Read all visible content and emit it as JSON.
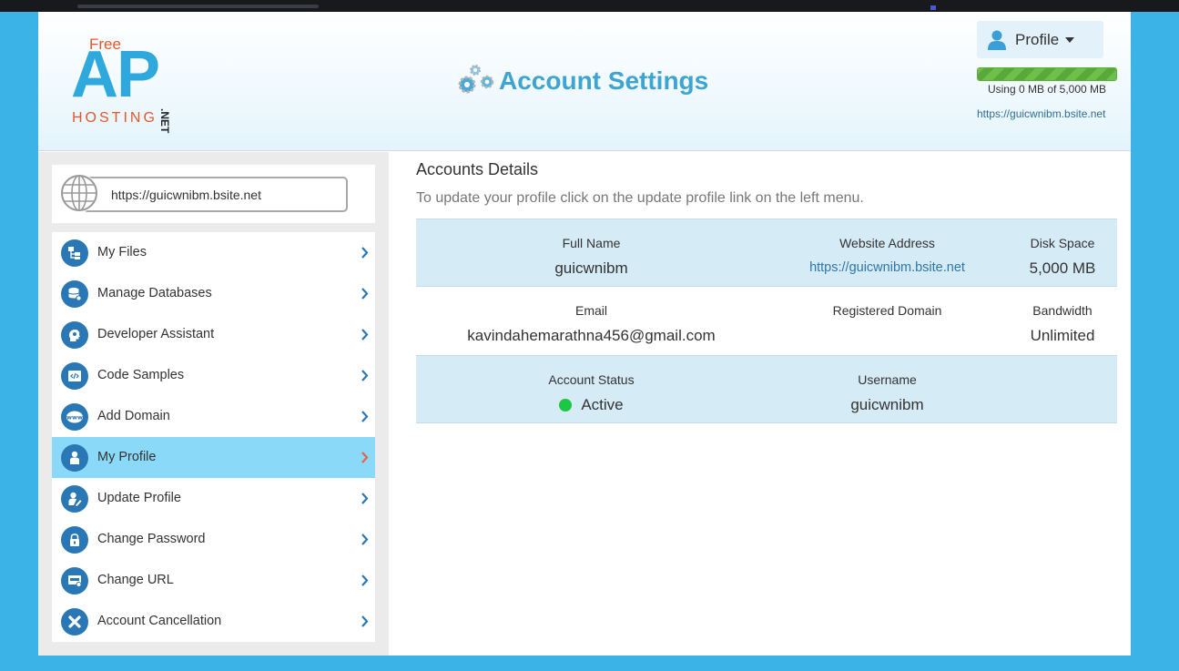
{
  "logo": {
    "free": "Free",
    "ap": "AP",
    "hosting": "HOSTING",
    "net": ".NET"
  },
  "header": {
    "title": "Account Settings",
    "profile_label": "Profile",
    "usage_text": "Using 0 MB of 5,000 MB",
    "usage_fraction": 0,
    "site_link": "https://guicwnibm.bsite.net"
  },
  "sidebar": {
    "url": "https://guicwnibm.bsite.net",
    "items": [
      {
        "label": "My Files",
        "icon": "files-icon"
      },
      {
        "label": "Manage Databases",
        "icon": "database-icon"
      },
      {
        "label": "Developer Assistant",
        "icon": "developer-head-icon"
      },
      {
        "label": "Code Samples",
        "icon": "code-icon"
      },
      {
        "label": "Add Domain",
        "icon": "www-icon"
      },
      {
        "label": "My Profile",
        "icon": "user-icon",
        "active": true
      },
      {
        "label": "Update Profile",
        "icon": "user-edit-icon"
      },
      {
        "label": "Change Password",
        "icon": "lock-icon"
      },
      {
        "label": "Change URL",
        "icon": "url-icon"
      },
      {
        "label": "Account Cancellation",
        "icon": "close-icon"
      }
    ]
  },
  "main": {
    "heading": "Accounts Details",
    "subtitle": "To update your profile click on the update profile link on the left menu.",
    "full_name_label": "Full Name",
    "full_name": "guicwnibm",
    "website_label": "Website Address",
    "website": "https://guicwnibm.bsite.net",
    "disk_label": "Disk Space",
    "disk": "5,000 MB",
    "email_label": "Email",
    "email": "kavindahemarathna456@gmail.com",
    "domain_label": "Registered Domain",
    "domain": "",
    "bandwidth_label": "Bandwidth",
    "bandwidth": "Unlimited",
    "status_label": "Account Status",
    "status": "Active",
    "username_label": "Username",
    "username": "guicwnibm"
  },
  "colors": {
    "accent": "#3ea4d2",
    "active_row": "#8ad9f8",
    "icon_circle": "#2a77b5",
    "status_active": "#1bc744",
    "page_bg": "#3bb3e6"
  }
}
